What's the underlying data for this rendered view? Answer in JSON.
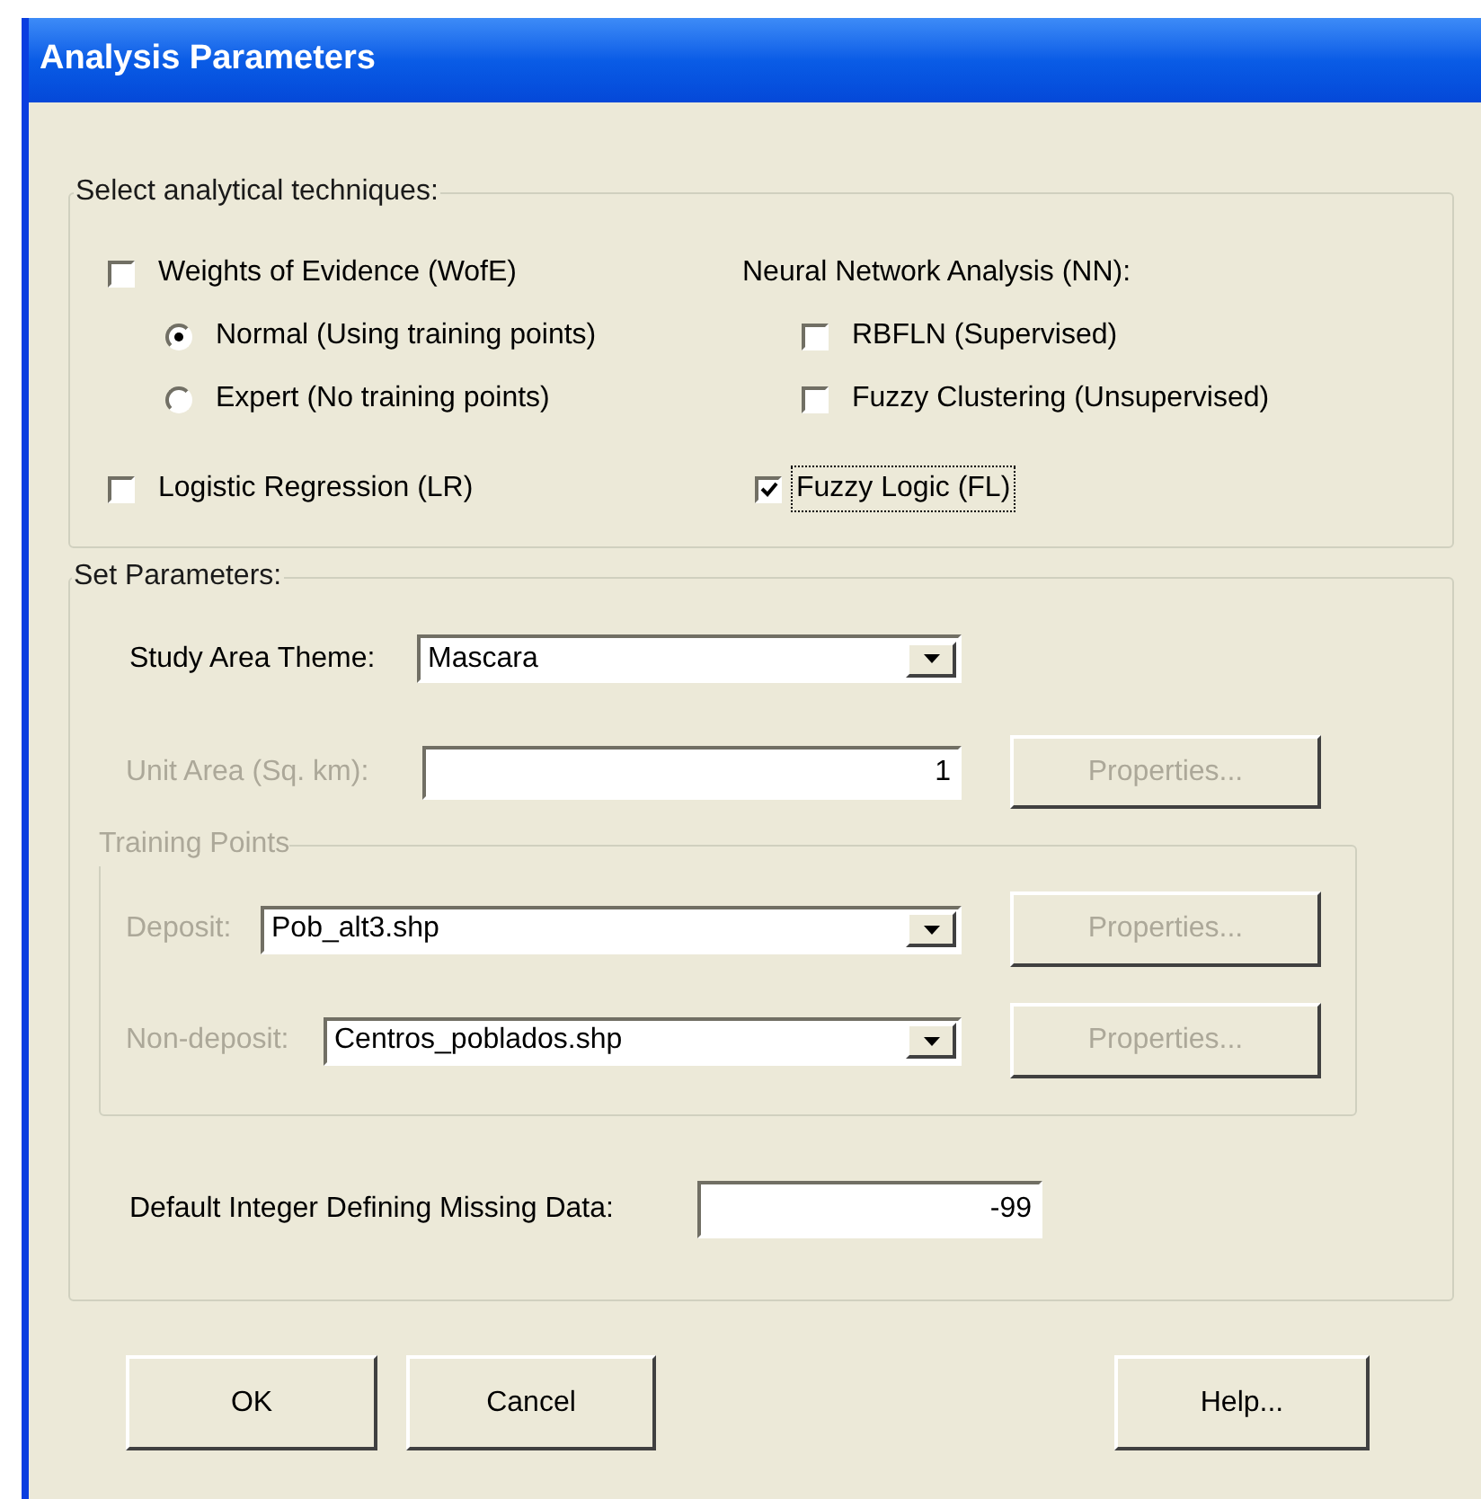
{
  "window": {
    "title": "Analysis Parameters"
  },
  "techniques": {
    "legend": "Select analytical techniques:",
    "wofe": {
      "label": "Weights of Evidence (WofE)",
      "checked": false,
      "options": [
        {
          "label": "Normal (Using training points)",
          "selected": true
        },
        {
          "label": "Expert (No training points)",
          "selected": false
        }
      ]
    },
    "logistic": {
      "label": "Logistic Regression (LR)",
      "checked": false
    },
    "nn": {
      "label": "Neural Network Analysis (NN):",
      "options": [
        {
          "label": "RBFLN (Supervised)",
          "checked": false
        },
        {
          "label": "Fuzzy Clustering (Unsupervised)",
          "checked": false
        }
      ]
    },
    "fuzzy_logic": {
      "label": "Fuzzy Logic (FL)",
      "checked": true,
      "focused": true
    }
  },
  "parameters": {
    "legend": "Set Parameters:",
    "study_area": {
      "label": "Study Area Theme:",
      "value": "Mascara",
      "disabled": false
    },
    "unit_area": {
      "label": "Unit Area (Sq. km):",
      "value": "1",
      "disabled": true,
      "button": {
        "label": "Properties...",
        "disabled": true
      }
    },
    "training_points": {
      "legend": "Training Points",
      "disabled": true,
      "rows": [
        {
          "label": "Deposit:",
          "value": "Pob_alt3.shp",
          "disabled": true,
          "button": {
            "label": "Properties...",
            "disabled": true
          }
        },
        {
          "label": "Non-deposit:",
          "value": "Centros_poblados.shp",
          "disabled": true,
          "button": {
            "label": "Properties...",
            "disabled": true
          }
        }
      ]
    },
    "missing_data": {
      "label": "Default Integer Defining Missing Data:",
      "value": "-99",
      "disabled": false
    }
  },
  "buttons": [
    {
      "label": "OK"
    },
    {
      "label": "Cancel"
    },
    {
      "label": "Help..."
    }
  ]
}
